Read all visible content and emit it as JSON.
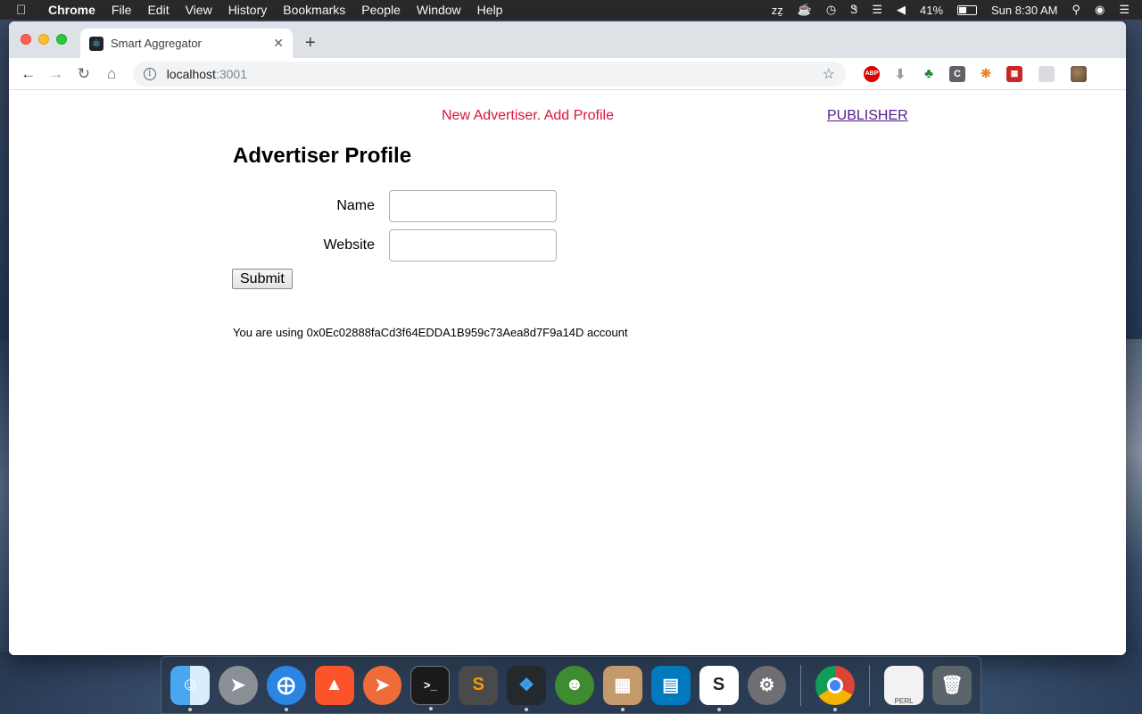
{
  "menubar": {
    "app_name": "Chrome",
    "menus": [
      "File",
      "Edit",
      "View",
      "History",
      "Bookmarks",
      "People",
      "Window",
      "Help"
    ],
    "battery": "41%",
    "clock": "Sun 8:30 AM"
  },
  "browser": {
    "tab_title": "Smart Aggregator",
    "url_host": "localhost",
    "url_port": ":3001"
  },
  "page": {
    "flash_message": "New Advertiser. Add Profile",
    "publisher_link": "PUBLISHER",
    "heading": "Advertiser Profile",
    "form": {
      "name_label": "Name",
      "name_value": "",
      "website_label": "Website",
      "website_value": "",
      "submit_label": "Submit"
    },
    "account_text": "You are using 0x0Ec02888faCd3f64EDDA1B959c73Aea8d7F9a14D account"
  },
  "colors": {
    "flash": "#dc143c",
    "link_visited": "#551a8b"
  },
  "dock": {
    "apps": [
      "finder",
      "launchpad",
      "safari",
      "brave",
      "postman",
      "terminal",
      "sublime-text",
      "vscode",
      "cyberduck",
      "sequel-pro",
      "trello",
      "slack",
      "system-preferences",
      "chrome",
      "perl-document",
      "trash"
    ]
  }
}
